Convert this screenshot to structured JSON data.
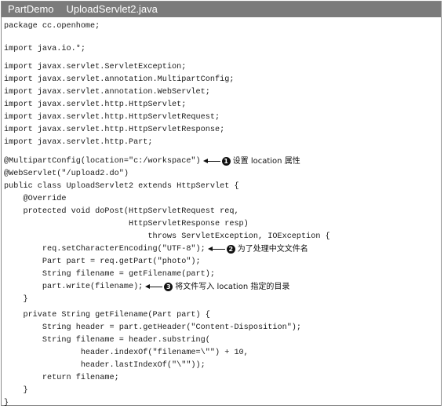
{
  "title": {
    "project": "PartDemo",
    "file": "UploadServlet2.java"
  },
  "code_lines": [
    "package cc.openhome;",
    "",
    "import java.io.*;",
    "",
    "import javax.servlet.ServletException;",
    "import javax.servlet.annotation.MultipartConfig;",
    "import javax.servlet.annotation.WebServlet;",
    "import javax.servlet.http.HttpServlet;",
    "import javax.servlet.http.HttpServletRequest;",
    "import javax.servlet.http.HttpServletResponse;",
    "import javax.servlet.http.Part;",
    "",
    "@MultipartConfig(location=\"c:/workspace\")",
    "@WebServlet(\"/upload2.do\")",
    "public class UploadServlet2 extends HttpServlet {",
    "    @Override",
    "    protected void doPost(HttpServletRequest req,",
    "                          HttpServletResponse resp)",
    "                              throws ServletException, IOException {",
    "        req.setCharacterEncoding(\"UTF-8\");",
    "        Part part = req.getPart(\"photo\");",
    "        String filename = getFilename(part);",
    "        part.write(filename);",
    "    }",
    "",
    "    private String getFilename(Part part) {",
    "        String header = part.getHeader(\"Content-Disposition\");",
    "        String filename = header.substring(",
    "                header.indexOf(\"filename=\\\"\") + 10,",
    "                header.lastIndexOf(\"\\\"\"));",
    "        return filename;",
    "    }",
    "}"
  ],
  "annotations": [
    {
      "marker": "1",
      "text": "设置 location 属性"
    },
    {
      "marker": "2",
      "text": "为了处理中文文件名"
    },
    {
      "marker": "3",
      "text": "将文件写入 location 指定的目录"
    }
  ],
  "colors": {
    "title_bar": "#7b7b7b",
    "title_text": "#ffffff",
    "code_text": "#1a1a1a"
  }
}
